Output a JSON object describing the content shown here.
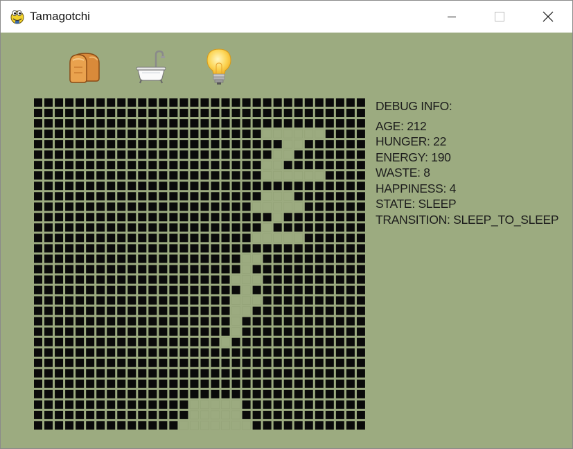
{
  "window": {
    "title": "Tamagotchi",
    "app_icon": "python-snake-icon",
    "controls": [
      "minimize-icon",
      "maximize-icon",
      "close-icon"
    ]
  },
  "toolbar": [
    {
      "icon": "bread-icon",
      "action": "feed"
    },
    {
      "icon": "bathtub-icon",
      "action": "clean"
    },
    {
      "icon": "light-bulb-icon",
      "action": "light"
    }
  ],
  "debug": {
    "heading": "DEBUG INFO:",
    "rows": [
      {
        "label": "AGE",
        "value": "212"
      },
      {
        "label": "HUNGER",
        "value": "22"
      },
      {
        "label": "ENERGY",
        "value": "190"
      },
      {
        "label": "WASTE",
        "value": "8"
      },
      {
        "label": "HAPPINESS",
        "value": "4"
      },
      {
        "label": "STATE",
        "value": "SLEEP"
      },
      {
        "label": "TRANSITION",
        "value": "SLEEP_TO_SLEEP"
      }
    ]
  },
  "lcd": {
    "columns": 32,
    "rows": 32,
    "on_color": "#0a0a0a",
    "off_color": "#9cab80",
    "off_cells": [
      [
        22,
        3
      ],
      [
        23,
        3
      ],
      [
        24,
        3
      ],
      [
        25,
        3
      ],
      [
        26,
        3
      ],
      [
        27,
        3
      ],
      [
        24,
        4
      ],
      [
        25,
        4
      ],
      [
        23,
        5
      ],
      [
        24,
        5
      ],
      [
        22,
        6
      ],
      [
        23,
        6
      ],
      [
        22,
        7
      ],
      [
        23,
        7
      ],
      [
        24,
        7
      ],
      [
        25,
        7
      ],
      [
        26,
        7
      ],
      [
        27,
        7
      ],
      [
        22,
        9
      ],
      [
        23,
        9
      ],
      [
        24,
        9
      ],
      [
        21,
        10
      ],
      [
        22,
        10
      ],
      [
        23,
        10
      ],
      [
        24,
        10
      ],
      [
        25,
        10
      ],
      [
        23,
        11
      ],
      [
        22,
        12
      ],
      [
        21,
        13
      ],
      [
        22,
        13
      ],
      [
        23,
        13
      ],
      [
        24,
        13
      ],
      [
        25,
        13
      ],
      [
        20,
        15
      ],
      [
        21,
        15
      ],
      [
        20,
        16
      ],
      [
        19,
        17
      ],
      [
        20,
        17
      ],
      [
        21,
        17
      ],
      [
        20,
        18
      ],
      [
        19,
        19
      ],
      [
        20,
        19
      ],
      [
        21,
        19
      ],
      [
        19,
        20
      ],
      [
        20,
        20
      ],
      [
        19,
        21
      ],
      [
        19,
        22
      ],
      [
        18,
        23
      ],
      [
        15,
        29
      ],
      [
        16,
        29
      ],
      [
        17,
        29
      ],
      [
        18,
        29
      ],
      [
        19,
        29
      ],
      [
        15,
        30
      ],
      [
        16,
        30
      ],
      [
        17,
        30
      ],
      [
        18,
        30
      ],
      [
        19,
        30
      ],
      [
        14,
        31
      ],
      [
        15,
        31
      ],
      [
        16,
        31
      ],
      [
        17,
        31
      ],
      [
        18,
        31
      ],
      [
        19,
        31
      ],
      [
        20,
        31
      ]
    ]
  }
}
